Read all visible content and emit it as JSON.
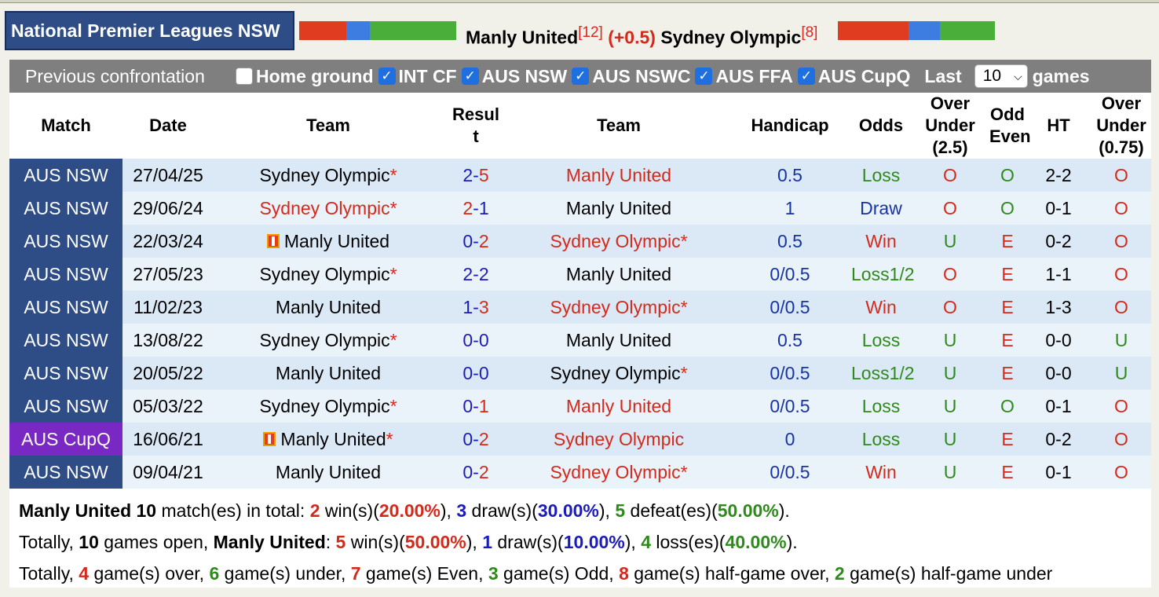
{
  "header": {
    "league": "National Premier Leagues NSW",
    "home_team": "Manly United",
    "home_rank": "[12]",
    "handicap": "(+0.5)",
    "away_team": "Sydney Olympic",
    "away_rank": "[8]",
    "colors": {
      "league_bg": "#2e4d86",
      "bar_red": "#e03c20",
      "bar_blue": "#3d7ce0",
      "bar_green": "#4aae3a"
    }
  },
  "filters": {
    "title": "Previous confrontation",
    "options": [
      {
        "label": "Home ground",
        "checked": false
      },
      {
        "label": "INT CF",
        "checked": true
      },
      {
        "label": "AUS NSW",
        "checked": true
      },
      {
        "label": "AUS NSWC",
        "checked": true
      },
      {
        "label": "AUS FFA",
        "checked": true
      },
      {
        "label": "AUS CupQ",
        "checked": true
      }
    ],
    "last_label": "Last",
    "last_value": "10",
    "games_label": "games"
  },
  "columns": {
    "match": "Match",
    "date": "Date",
    "team1": "Team",
    "result_a": "Resul",
    "result_b": "t",
    "team2": "Team",
    "handicap": "Handicap",
    "odds": "Odds",
    "ou_a": "Over",
    "ou_b": "Under",
    "ou_c": "(2.5)",
    "oe_a": "Odd",
    "oe_b": "Even",
    "ht": "HT",
    "ou2_a": "Over",
    "ou2_b": "Under",
    "ou2_c": "(0.75)"
  },
  "rows": [
    {
      "league": "AUS NSW",
      "date": "27/04/25",
      "home": "Sydney Olympic",
      "home_star": "*",
      "home_red": false,
      "home_flag": false,
      "score_h": "2",
      "score_a": "5",
      "away": "Manly United",
      "away_star": "",
      "away_red": true,
      "handicap": "0.5",
      "odds": "Loss",
      "ou": "O",
      "oe": "O",
      "ht": "2-2",
      "ou2": "O"
    },
    {
      "league": "AUS NSW",
      "date": "29/06/24",
      "home": "Sydney Olympic",
      "home_star": "*",
      "home_red": true,
      "home_flag": false,
      "score_h": "2",
      "score_a": "1",
      "away": "Manly United",
      "away_star": "",
      "away_red": false,
      "handicap": "1",
      "odds": "Draw",
      "ou": "O",
      "oe": "O",
      "ht": "0-1",
      "ou2": "O"
    },
    {
      "league": "AUS NSW",
      "date": "22/03/24",
      "home": "Manly United",
      "home_star": "",
      "home_red": false,
      "home_flag": true,
      "score_h": "0",
      "score_a": "2",
      "away": "Sydney Olympic",
      "away_star": "*",
      "away_red": true,
      "handicap": "0.5",
      "odds": "Win",
      "ou": "U",
      "oe": "E",
      "ht": "0-2",
      "ou2": "O"
    },
    {
      "league": "AUS NSW",
      "date": "27/05/23",
      "home": "Sydney Olympic",
      "home_star": "*",
      "home_red": false,
      "home_flag": false,
      "score_h": "2",
      "score_a": "2",
      "away": "Manly United",
      "away_star": "",
      "away_red": false,
      "handicap": "0/0.5",
      "odds": "Loss1/2",
      "ou": "O",
      "oe": "E",
      "ht": "1-1",
      "ou2": "O"
    },
    {
      "league": "AUS NSW",
      "date": "11/02/23",
      "home": "Manly United",
      "home_star": "",
      "home_red": false,
      "home_flag": false,
      "score_h": "1",
      "score_a": "3",
      "away": "Sydney Olympic",
      "away_star": "*",
      "away_red": true,
      "handicap": "0/0.5",
      "odds": "Win",
      "ou": "O",
      "oe": "E",
      "ht": "1-3",
      "ou2": "O"
    },
    {
      "league": "AUS NSW",
      "date": "13/08/22",
      "home": "Sydney Olympic",
      "home_star": "*",
      "home_red": false,
      "home_flag": false,
      "score_h": "0",
      "score_a": "0",
      "away": "Manly United",
      "away_star": "",
      "away_red": false,
      "handicap": "0.5",
      "odds": "Loss",
      "ou": "U",
      "oe": "E",
      "ht": "0-0",
      "ou2": "U"
    },
    {
      "league": "AUS NSW",
      "date": "20/05/22",
      "home": "Manly United",
      "home_star": "",
      "home_red": false,
      "home_flag": false,
      "score_h": "0",
      "score_a": "0",
      "away": "Sydney Olympic",
      "away_star": "*",
      "away_red": false,
      "handicap": "0/0.5",
      "odds": "Loss1/2",
      "ou": "U",
      "oe": "E",
      "ht": "0-0",
      "ou2": "U"
    },
    {
      "league": "AUS NSW",
      "date": "05/03/22",
      "home": "Sydney Olympic",
      "home_star": "*",
      "home_red": false,
      "home_flag": false,
      "score_h": "0",
      "score_a": "1",
      "away": "Manly United",
      "away_star": "",
      "away_red": true,
      "handicap": "0/0.5",
      "odds": "Loss",
      "ou": "U",
      "oe": "O",
      "ht": "0-1",
      "ou2": "O"
    },
    {
      "league": "AUS CupQ",
      "date": "16/06/21",
      "home": "Manly United",
      "home_star": "*",
      "home_red": false,
      "home_flag": true,
      "score_h": "0",
      "score_a": "2",
      "away": "Sydney Olympic",
      "away_star": "",
      "away_red": true,
      "handicap": "0",
      "odds": "Loss",
      "ou": "U",
      "oe": "E",
      "ht": "0-2",
      "ou2": "O"
    },
    {
      "league": "AUS NSW",
      "date": "09/04/21",
      "home": "Manly United",
      "home_star": "",
      "home_red": false,
      "home_flag": false,
      "score_h": "0",
      "score_a": "2",
      "away": "Sydney Olympic",
      "away_star": "*",
      "away_red": true,
      "handicap": "0/0.5",
      "odds": "Win",
      "ou": "U",
      "oe": "E",
      "ht": "0-1",
      "ou2": "O"
    }
  ],
  "summary": {
    "line1": {
      "team": "Manly United",
      "total": "10",
      "t1": " match(es) in total: ",
      "wins": "2",
      "t2": " win(s)(",
      "win_pct": "20.00%",
      "t3": "), ",
      "draws": "3",
      "t4": " draw(s)(",
      "draw_pct": "30.00%",
      "t5": "), ",
      "defeats": "5",
      "t6": " defeat(es)(",
      "defeat_pct": "50.00%",
      "t7": ")."
    },
    "line2": {
      "t0": "Totally, ",
      "total": "10",
      "t1": " games open, ",
      "team": "Manly United",
      "t2": ": ",
      "wins": "5",
      "t3": " win(s)(",
      "win_pct": "50.00%",
      "t4": "), ",
      "draws": "1",
      "t5": " draw(s)(",
      "draw_pct": "10.00%",
      "t6": "), ",
      "losses": "4",
      "t7": " loss(es)(",
      "loss_pct": "40.00%",
      "t8": ")."
    },
    "line3": {
      "t0": "Totally, ",
      "over": "4",
      "t1": " game(s) over, ",
      "under": "6",
      "t2": " game(s) under, ",
      "even": "7",
      "t3": " game(s) Even, ",
      "odd": "3",
      "t4": " game(s) Odd, ",
      "half_over": "8",
      "t5": " game(s) half-game over, ",
      "half_under": "2",
      "t6": " game(s) half-game under"
    }
  }
}
